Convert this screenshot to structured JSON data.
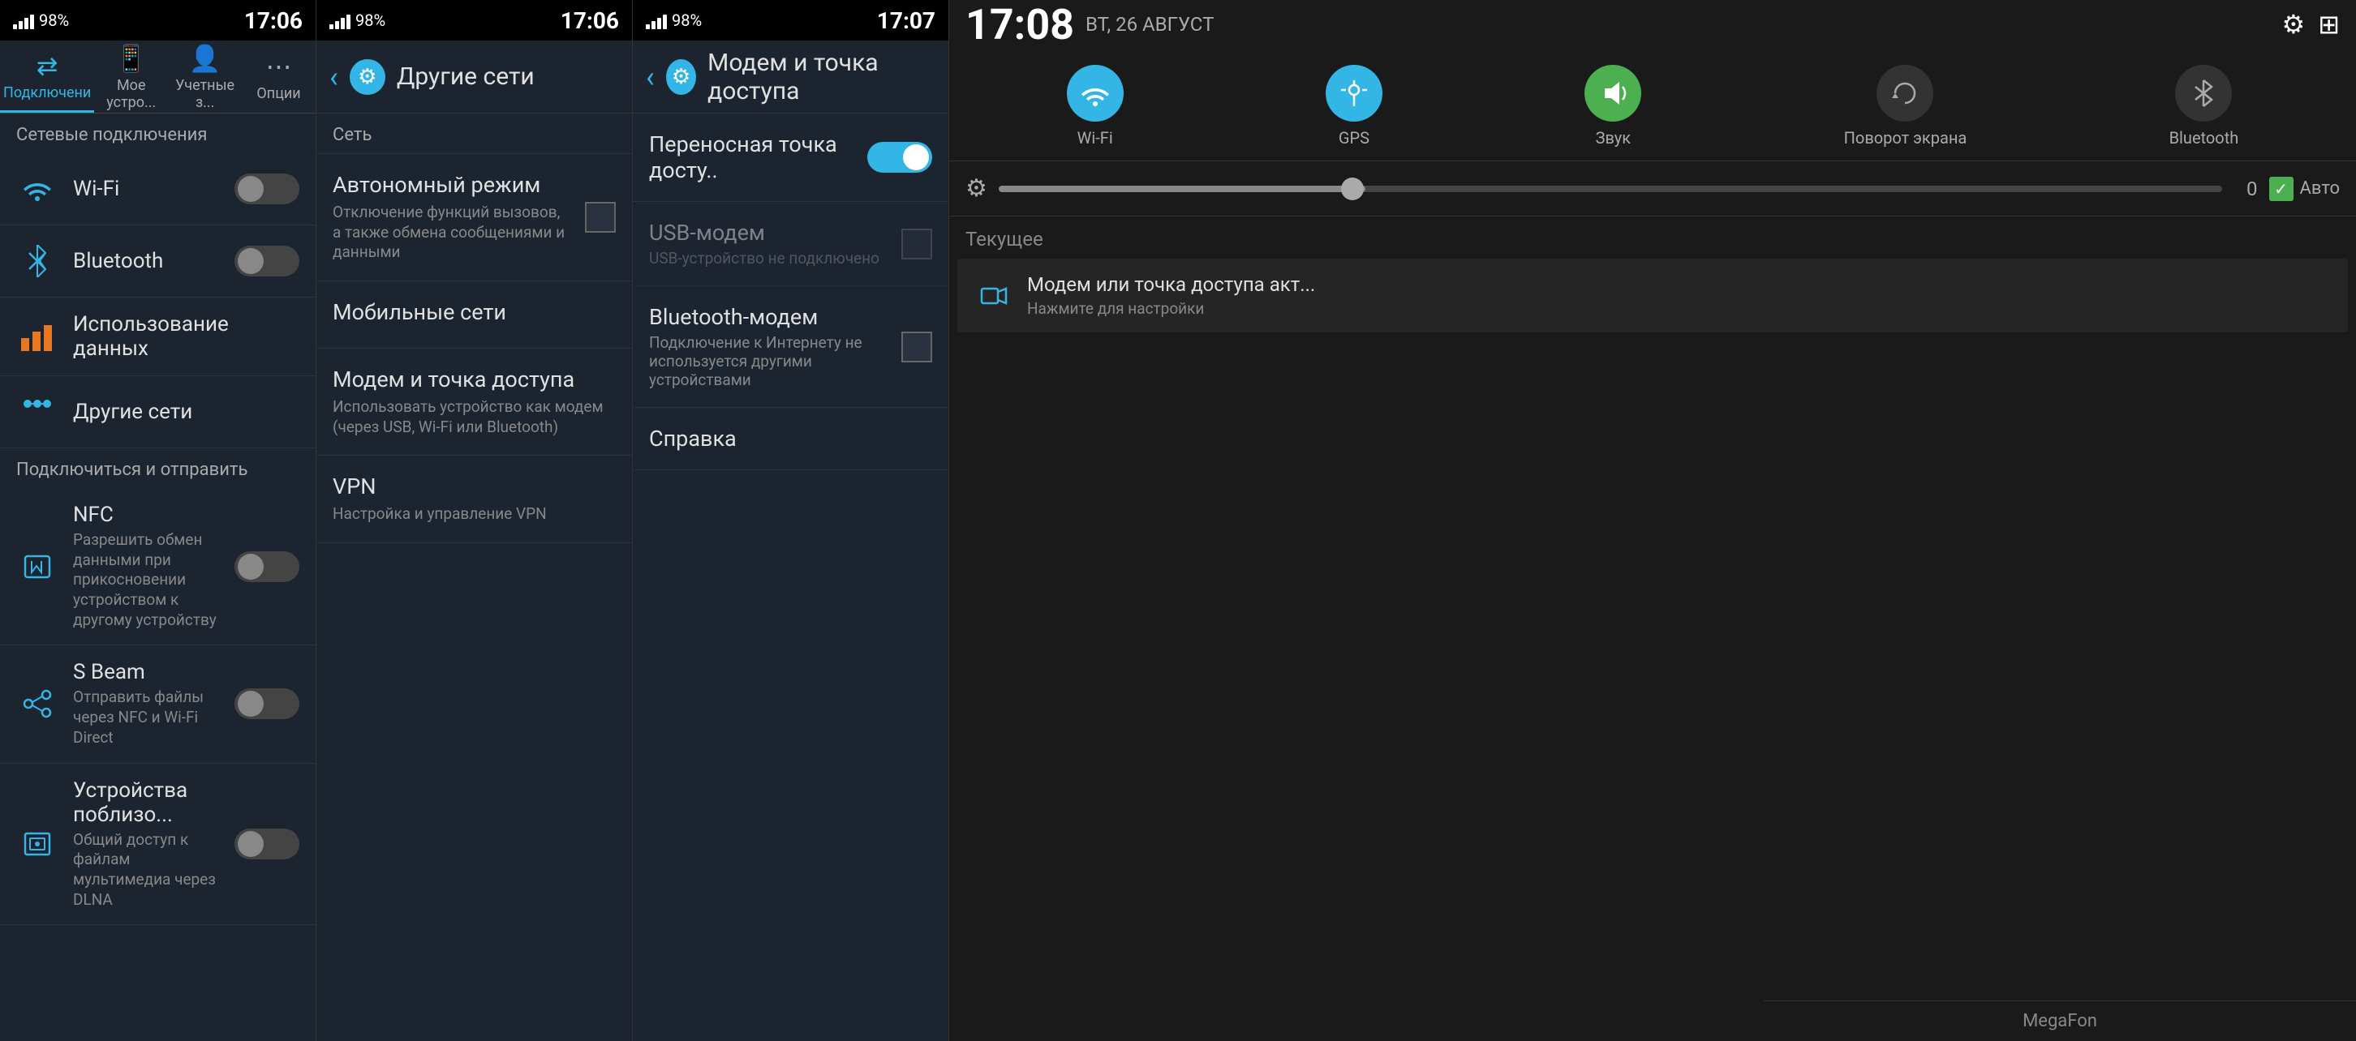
{
  "panel1": {
    "status": {
      "time": "17:06",
      "battery": "98%",
      "signal": "▲"
    },
    "tabs": [
      {
        "id": "connections",
        "label": "Подключени",
        "active": true
      },
      {
        "id": "mydevice",
        "label": "Мое устро...",
        "active": false
      },
      {
        "id": "accounts",
        "label": "Учетные з...",
        "active": false
      },
      {
        "id": "options",
        "label": "Опции",
        "active": false
      }
    ],
    "section_label": "Сетевые подключения",
    "items": [
      {
        "id": "wifi",
        "title": "Wi-Fi",
        "type": "toggle",
        "toggle_state": "off"
      },
      {
        "id": "bluetooth",
        "title": "Bluetooth",
        "type": "toggle",
        "toggle_state": "off"
      },
      {
        "id": "data_usage",
        "title": "Использование данных",
        "type": "none"
      },
      {
        "id": "other_networks",
        "title": "Другие сети",
        "type": "none"
      }
    ],
    "section2_label": "Подключиться и отправить",
    "items2": [
      {
        "id": "nfc",
        "title": "NFC",
        "subtitle": "Разрешить обмен данными при прикосновении устройством к другому устройству",
        "type": "toggle",
        "toggle_state": "off"
      },
      {
        "id": "sbeam",
        "title": "S Beam",
        "subtitle": "Отправить файлы через NFC и Wi-Fi Direct",
        "type": "toggle",
        "toggle_state": "off"
      },
      {
        "id": "nearby",
        "title": "Устройства поблизо...",
        "subtitle": "Общий доступ к файлам мультимедиа через DLNA",
        "type": "toggle",
        "toggle_state": "off"
      }
    ]
  },
  "panel2": {
    "status": {
      "time": "17:06"
    },
    "title": "Другие сети",
    "section_label": "Сеть",
    "items": [
      {
        "id": "airplane",
        "title": "Автономный режим",
        "desc": "Отключение функций вызовов, а также обмена сообщениями и данными",
        "has_checkbox": true
      },
      {
        "id": "mobile",
        "title": "Мобильные сети",
        "desc": "",
        "has_checkbox": false
      },
      {
        "id": "tethering",
        "title": "Модем и точка доступа",
        "desc": "Использовать устройство как модем (через USB, Wi-Fi или Bluetooth)",
        "has_checkbox": false
      },
      {
        "id": "vpn",
        "title": "VPN",
        "desc": "Настройка и управление VPN",
        "has_checkbox": false
      }
    ]
  },
  "panel3": {
    "status": {
      "time": "17:07"
    },
    "title": "Модем и точка доступа",
    "items": [
      {
        "id": "hotspot",
        "title": "Переносная точка досту..",
        "desc": "",
        "type": "toggle_on"
      },
      {
        "id": "usb_modem",
        "title": "USB-модем",
        "desc": "USB-устройство не подключено",
        "type": "checkbox",
        "checked": false,
        "disabled": true
      },
      {
        "id": "bt_modem",
        "title": "Bluetooth-модем",
        "desc": "Подключение к Интернету не используется другими устройствами",
        "type": "checkbox",
        "checked": false
      },
      {
        "id": "help",
        "title": "Справка",
        "desc": "",
        "type": "none"
      }
    ]
  },
  "panel4": {
    "time": "17:08",
    "date": "ВТ, 26 АВГУСТ",
    "quick_settings": [
      {
        "id": "wifi",
        "label": "Wi-Fi",
        "active": true
      },
      {
        "id": "gps",
        "label": "GPS",
        "active": true
      },
      {
        "id": "sound",
        "label": "Звук",
        "active": true
      },
      {
        "id": "rotate",
        "label": "Поворот экрана",
        "active": false
      },
      {
        "id": "bluetooth",
        "label": "Bluetooth",
        "active": false
      }
    ],
    "brightness": {
      "value": "0",
      "auto_label": "Авто",
      "auto_checked": true
    },
    "current_section": "Текущее",
    "notification": {
      "title": "Модем или точка доступа акт...",
      "desc": "Нажмите для настройки"
    },
    "footer": "MegaFon"
  }
}
